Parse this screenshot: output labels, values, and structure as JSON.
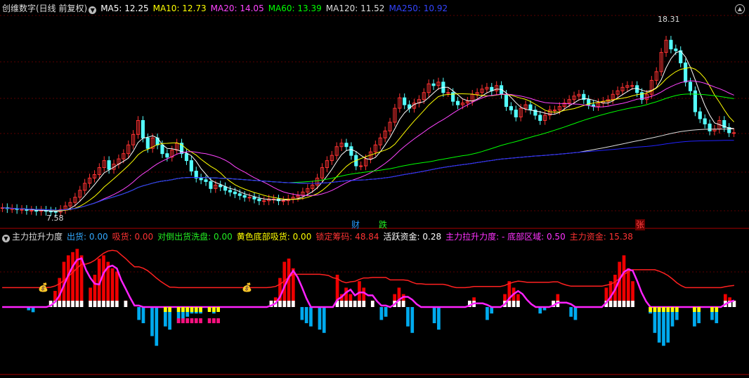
{
  "colors": {
    "ma5": "#ffffff",
    "ma10": "#ffff00",
    "ma20": "#ff44ff",
    "ma60": "#00ff00",
    "ma120": "#dddddd",
    "ma250": "#2222ff",
    "up": "#ff3232",
    "down": "#54ffff",
    "grid": "#5a0000",
    "red_bar": "#ee0000",
    "cyan_bar": "#00aaee",
    "magenta_line": "#ff22ff",
    "red_line": "#ff2020",
    "yellow_mark": "#ffff00",
    "pink_mark": "#ff1080",
    "green_bar": "#22cc22"
  },
  "header": {
    "title": "创维数字(日线 前复权)",
    "ma5": "MA5: 12.25",
    "ma10": "MA10: 12.73",
    "ma20": "MA20: 14.05",
    "ma60": "MA60: 13.39",
    "ma120": "MA120: 11.52",
    "ma250": "MA250: 10.92"
  },
  "price_labels": {
    "high": "18.31",
    "low": "7.58"
  },
  "markers": {
    "cai": "财",
    "die": "跌",
    "zhang": "张"
  },
  "sub_header": {
    "title": "主力拉升力度",
    "chuhuo": "出货: 0.00",
    "xihuo": "吸货: 0.00",
    "duidao": "对倒出货洗盘: 0.00",
    "huangse": "黄色底部吸货: 0.00",
    "suoding": "锁定筹码: 48.84",
    "huoyue": "活跃资金: 0.28",
    "lasheng": "主力拉升力度: - 底部区域: 0.50",
    "zhuli": "主力资金: 15.38"
  },
  "chart_data": [
    {
      "type": "candlestick",
      "title": "创维数字(日线 前复权)",
      "ylim": [
        7.0,
        19.0
      ],
      "x": [
        0,
        1,
        2,
        3,
        4,
        5,
        6,
        7,
        8,
        9,
        10,
        11,
        12,
        13,
        14,
        15,
        16,
        17,
        18,
        19,
        20,
        21,
        22,
        23,
        24,
        25,
        26,
        27,
        28,
        29,
        30,
        31,
        32,
        33,
        34,
        35,
        36,
        37,
        38,
        39,
        40,
        41,
        42,
        43,
        44,
        45,
        46,
        47,
        48,
        49,
        50,
        51,
        52,
        53,
        54,
        55,
        56,
        57,
        58,
        59,
        60,
        61,
        62,
        63,
        64,
        65,
        66,
        67,
        68,
        69,
        70,
        71,
        72,
        73,
        74,
        75,
        76,
        77,
        78,
        79,
        80,
        81,
        82,
        83,
        84,
        85,
        86,
        87,
        88,
        89,
        90,
        91,
        92,
        93,
        94,
        95,
        96,
        97,
        98,
        99,
        100,
        101,
        102,
        103,
        104,
        105,
        106,
        107,
        108,
        109,
        110,
        111,
        112,
        113,
        114,
        115,
        116,
        117,
        118,
        119,
        120,
        121,
        122,
        123,
        124,
        125,
        126,
        127,
        128,
        129,
        130,
        131,
        132,
        133,
        134,
        135,
        136,
        137,
        138,
        139,
        140,
        141,
        142,
        143,
        144,
        145,
        146,
        147,
        148,
        149,
        150,
        151,
        152,
        153,
        154,
        155,
        156,
        157,
        158,
        159,
        160,
        161,
        162,
        163,
        164,
        165,
        166,
        167,
        168,
        169,
        170,
        171,
        172,
        173,
        174,
        175,
        176,
        177,
        178,
        179,
        180,
        181,
        182,
        183,
        184,
        185,
        186,
        187,
        188,
        189,
        190,
        191,
        192,
        193,
        194,
        195,
        196,
        197,
        198,
        199,
        200,
        201,
        202,
        203,
        204,
        205,
        206,
        207,
        208,
        209
      ],
      "close": [
        7.9,
        7.85,
        7.85,
        7.8,
        7.8,
        7.75,
        7.75,
        7.7,
        7.75,
        7.7,
        7.68,
        7.65,
        7.8,
        8.0,
        8.2,
        8.5,
        8.9,
        9.3,
        9.6,
        9.8,
        10.2,
        10.6,
        10.1,
        10.4,
        10.7,
        11.0,
        11.5,
        12.1,
        12.9,
        11.9,
        11.3,
        11.9,
        11.5,
        11.0,
        10.8,
        11.2,
        11.6,
        11.0,
        10.6,
        10.0,
        9.6,
        9.5,
        9.4,
        9.0,
        9.2,
        9.1,
        8.9,
        8.8,
        8.7,
        8.6,
        8.5,
        8.5,
        8.4,
        8.3,
        8.3,
        8.4,
        8.4,
        8.3,
        8.3,
        8.4,
        8.5,
        8.6,
        8.8,
        9.0,
        9.2,
        9.6,
        10.2,
        10.6,
        10.9,
        11.4,
        11.6,
        11.4,
        10.9,
        10.3,
        10.3,
        10.7,
        11.1,
        11.5,
        11.9,
        12.3,
        12.8,
        13.6,
        14.2,
        13.8,
        13.6,
        13.9,
        14.1,
        14.5,
        15.0,
        14.9,
        15.1,
        14.5,
        14.5,
        14.0,
        13.8,
        13.9,
        14.0,
        14.4,
        14.5,
        14.7,
        14.8,
        14.6,
        14.9,
        14.4,
        13.7,
        13.5,
        13.1,
        13.6,
        13.8,
        13.5,
        13.2,
        12.9,
        13.2,
        13.5,
        13.5,
        13.7,
        13.9,
        14.1,
        14.3,
        14.4,
        14.1,
        13.8,
        13.7,
        13.9,
        14.0,
        14.1,
        14.4,
        14.6,
        14.8,
        14.9,
        14.9,
        14.5,
        14.1,
        14.4,
        15.2,
        15.7,
        16.8,
        17.5,
        17.0,
        16.9,
        16.2,
        15.1,
        14.6,
        13.4,
        13.0,
        12.7,
        12.3,
        12.4,
        12.9,
        12.5,
        12.2,
        12.2
      ],
      "series": [
        {
          "name": "MA5",
          "color_key": "ma5"
        },
        {
          "name": "MA10",
          "color_key": "ma10"
        },
        {
          "name": "MA20",
          "color_key": "ma20"
        },
        {
          "name": "MA60",
          "color_key": "ma60"
        },
        {
          "name": "MA120",
          "color_key": "ma120"
        },
        {
          "name": "MA250",
          "color_key": "ma250"
        }
      ]
    },
    {
      "type": "bar",
      "title": "主力拉升力度",
      "ylim": [
        -100,
        100
      ],
      "x": [
        0,
        1,
        2,
        3,
        4,
        5,
        6,
        7,
        8,
        9,
        10,
        11,
        12,
        13,
        14,
        15,
        16,
        17,
        18,
        19,
        20,
        21,
        22,
        23,
        24,
        25,
        26,
        27,
        28,
        29,
        30,
        31,
        32,
        33,
        34,
        35,
        36,
        37,
        38,
        39,
        40,
        41,
        42,
        43,
        44,
        45,
        46,
        47,
        48,
        49,
        50,
        51,
        52,
        53,
        54,
        55,
        56,
        57,
        58,
        59,
        60,
        61,
        62,
        63,
        64,
        65,
        66,
        67,
        68,
        69,
        70,
        71,
        72,
        73,
        74,
        75,
        76,
        77,
        78,
        79,
        80,
        81,
        82,
        83,
        84,
        85,
        86,
        87,
        88,
        89,
        90,
        91,
        92,
        93,
        94,
        95,
        96,
        97,
        98,
        99,
        100,
        101,
        102,
        103,
        104,
        105,
        106,
        107,
        108,
        109,
        110,
        111,
        112,
        113,
        114,
        115,
        116,
        117,
        118,
        119,
        120,
        121,
        122,
        123,
        124,
        125,
        126,
        127,
        128,
        129,
        130,
        131,
        132,
        133,
        134,
        135,
        136,
        137,
        138,
        139,
        140,
        141,
        142,
        143,
        144,
        145,
        146,
        147,
        148,
        149,
        150,
        151,
        152,
        153,
        154,
        155,
        156,
        157,
        158,
        159,
        160,
        161,
        162,
        163,
        164,
        165,
        166,
        167,
        168,
        169,
        170,
        171,
        172,
        173,
        174,
        175,
        176,
        177,
        178,
        179,
        180,
        181,
        182,
        183,
        184,
        185,
        186,
        187,
        188,
        189,
        190,
        191,
        192,
        193,
        194,
        195,
        196,
        197,
        198,
        199,
        200,
        201,
        202,
        203,
        204,
        205,
        206,
        207,
        208,
        209
      ],
      "values": [
        0,
        0,
        0,
        0,
        0,
        0,
        -5,
        -8,
        0,
        0,
        0,
        10,
        25,
        45,
        70,
        80,
        85,
        90,
        80,
        0,
        30,
        50,
        75,
        80,
        70,
        60,
        55,
        0,
        10,
        0,
        0,
        -20,
        -25,
        0,
        -45,
        -60,
        0,
        -30,
        -35,
        0,
        -25,
        -20,
        -15,
        -10,
        -10,
        -10,
        0,
        -5,
        -10,
        -5,
        0,
        0,
        0,
        0,
        0,
        0,
        0,
        0,
        0,
        0,
        0,
        10,
        15,
        45,
        70,
        75,
        60,
        0,
        -20,
        -25,
        -30,
        0,
        -35,
        -40,
        0,
        0,
        50,
        20,
        30,
        20,
        10,
        40,
        30,
        0,
        10,
        0,
        -20,
        -15,
        0,
        20,
        30,
        20,
        -30,
        -40,
        0,
        0,
        0,
        0,
        -25,
        -35,
        0,
        0,
        0,
        0,
        0,
        0,
        10,
        15,
        0,
        0,
        -20,
        -10,
        0,
        0,
        20,
        40,
        30,
        20,
        0,
        0,
        0,
        0,
        -10,
        -5,
        0,
        10,
        20,
        0,
        0,
        -15,
        -20,
        0,
        0,
        0,
        0,
        0,
        0,
        30,
        40,
        50,
        70,
        80,
        60,
        40,
        0,
        0,
        0,
        -10,
        -40,
        -55,
        -60,
        -55,
        -30,
        -20,
        0,
        0,
        0,
        -30,
        -25,
        0,
        0,
        -20,
        -25,
        0,
        20,
        15,
        10
      ]
    }
  ]
}
